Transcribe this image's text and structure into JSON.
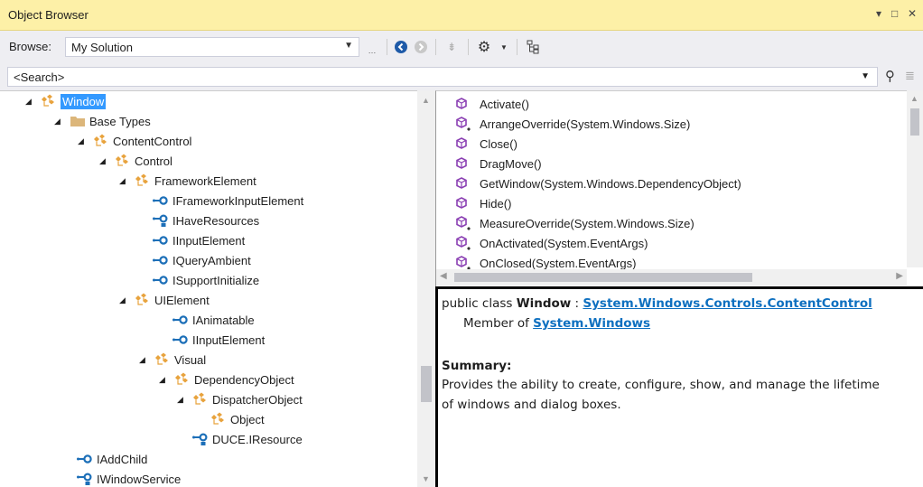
{
  "window": {
    "title": "Object Browser",
    "controls": [
      "▾",
      "□",
      "✕"
    ]
  },
  "toolbar": {
    "browse_label": "Browse:",
    "browse_value": "My Solution"
  },
  "search": {
    "placeholder": "<Search>"
  },
  "tree": [
    {
      "label": "Window",
      "icon": "class-icon",
      "expander": "◢",
      "selected": true
    },
    {
      "label": "Base Types",
      "icon": "folder-icon",
      "expander": "◢"
    },
    {
      "label": "ContentControl",
      "icon": "class-icon",
      "expander": "◢"
    },
    {
      "label": "Control",
      "icon": "class-icon",
      "expander": "◢"
    },
    {
      "label": "FrameworkElement",
      "icon": "class-icon",
      "expander": "◢"
    },
    {
      "label": "IFrameworkInputElement",
      "icon": "interface-icon"
    },
    {
      "label": "IHaveResources",
      "icon": "internal-interface-icon"
    },
    {
      "label": "IInputElement",
      "icon": "interface-icon"
    },
    {
      "label": "IQueryAmbient",
      "icon": "interface-icon"
    },
    {
      "label": "ISupportInitialize",
      "icon": "interface-icon"
    },
    {
      "label": "UIElement",
      "icon": "class-icon",
      "expander": "◢"
    },
    {
      "label": "IAnimatable",
      "icon": "interface-icon"
    },
    {
      "label": "IInputElement",
      "icon": "interface-icon"
    },
    {
      "label": "Visual",
      "icon": "class-icon",
      "expander": "◢"
    },
    {
      "label": "DependencyObject",
      "icon": "class-icon",
      "expander": "◢"
    },
    {
      "label": "DispatcherObject",
      "icon": "class-icon",
      "expander": "◢"
    },
    {
      "label": "Object",
      "icon": "class-icon"
    },
    {
      "label": "DUCE.IResource",
      "icon": "internal-interface-icon"
    },
    {
      "label": "IAddChild",
      "icon": "interface-icon"
    },
    {
      "label": "IWindowService",
      "icon": "internal-interface-icon"
    }
  ],
  "members": [
    {
      "label": "Activate()",
      "icon": "method-icon"
    },
    {
      "label": "ArrangeOverride(System.Windows.Size)",
      "icon": "protected-method-icon"
    },
    {
      "label": "Close()",
      "icon": "method-icon"
    },
    {
      "label": "DragMove()",
      "icon": "method-icon"
    },
    {
      "label": "GetWindow(System.Windows.DependencyObject)",
      "icon": "method-icon"
    },
    {
      "label": "Hide()",
      "icon": "method-icon"
    },
    {
      "label": "MeasureOverride(System.Windows.Size)",
      "icon": "protected-method-icon"
    },
    {
      "label": "OnActivated(System.EventArgs)",
      "icon": "protected-method-icon"
    },
    {
      "label": "OnClosed(System.EventArgs)",
      "icon": "protected-method-icon"
    }
  ],
  "description": {
    "decl_prefix": "public class ",
    "class_name": "Window",
    "decl_sep": " : ",
    "base_link": "System.Windows.Controls.ContentControl",
    "member_of_prefix": "Member of ",
    "namespace_link": "System.Windows",
    "summary_heading": "Summary:",
    "summary_line1": "Provides the ability to create, configure, show, and manage the lifetime",
    "summary_line2": "of windows and dialog boxes."
  },
  "colors": {
    "title_bg": "#fdf0a7",
    "selection": "#3399ff",
    "link": "#0e70c0",
    "class_icon": "#e8a33d",
    "interface_icon": "#1c6fb8",
    "method_icon": "#8a3fb3"
  }
}
